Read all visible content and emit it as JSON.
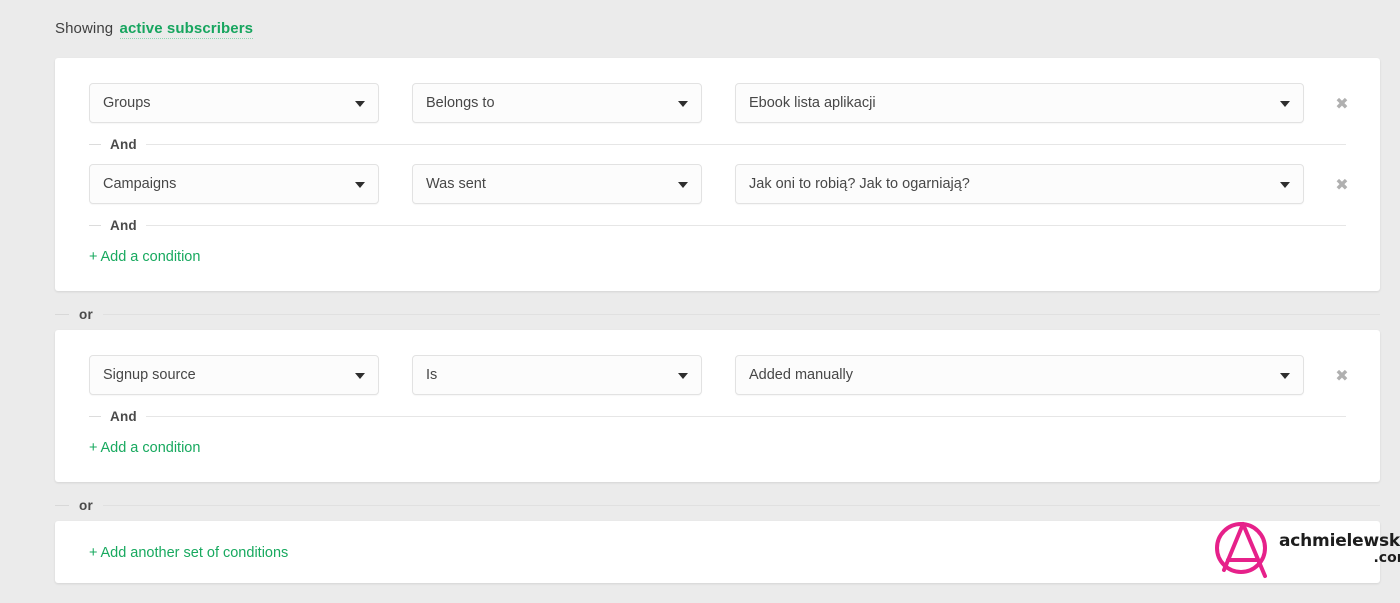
{
  "header": {
    "showing_label": "Showing",
    "showing_value": "active subscribers"
  },
  "separators": {
    "and": "And",
    "or": "or"
  },
  "links": {
    "add_condition": "Add a condition",
    "add_another_set": "Add another set of conditions",
    "plus": "+"
  },
  "icons": {
    "remove": "✖",
    "caret": "caret-down-icon"
  },
  "colors": {
    "accent_green": "#18a95f",
    "page_background": "#ebebeb",
    "card_background": "#ffffff",
    "select_background": "#fcfcfc",
    "select_border": "#e2e2e2",
    "text": "#474747",
    "logo_pink": "#e6218a"
  },
  "groups": [
    {
      "conditions": [
        {
          "field": "Groups",
          "operator": "Belongs to",
          "value": "Ebook lista aplikacji"
        },
        {
          "field": "Campaigns",
          "operator": "Was sent",
          "value": "Jak oni to robią? Jak to ogarniają?"
        }
      ]
    },
    {
      "conditions": [
        {
          "field": "Signup source",
          "operator": "Is",
          "value": "Added manually"
        }
      ]
    }
  ],
  "watermark": {
    "name": "achmielewska",
    "tld": ".com"
  }
}
